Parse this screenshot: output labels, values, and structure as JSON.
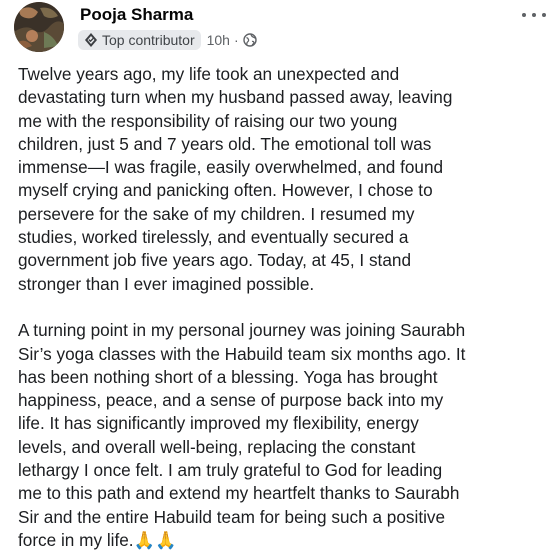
{
  "post": {
    "author_name": "Pooja Sharma",
    "badge_label": "Top contributor",
    "timestamp": "10h",
    "separator": "·",
    "audience_icon": "globe-icon",
    "badge_icon": "top-contributor-icon",
    "more_icon": "more-options-icon",
    "paragraphs": [
      "Twelve years ago, my life took an unexpected and\ndevastating turn when my husband passed away, leaving\nme with the responsibility of raising our two young\nchildren, just 5 and 7 years old. The emotional toll was\nimmense—I was fragile, easily overwhelmed, and found\nmyself crying and panicking often. However, I chose to\npersevere for the sake of my children. I resumed my\nstudies, worked tirelessly, and eventually secured a\ngovernment job five years ago. Today, at 45, I stand\nstronger than I ever imagined possible.",
      "A turning point in my personal journey was joining Saurabh\nSir’s yoga classes with the Habuild team six months ago. It\nhas been nothing short of a blessing. Yoga has brought\nhappiness, peace, and a sense of purpose back into my\nlife. It has significantly improved my flexibility, energy\nlevels, and overall well-being, replacing the constant\nlethargy I once felt. I am truly grateful to God for leading\nme to this path and extend my heartfelt thanks to Saurabh\nSir and the entire Habuild team for being such a positive\nforce in my life.🙏🙏"
    ]
  },
  "colors": {
    "text_primary": "#050505",
    "text_secondary": "#5f6266",
    "badge_bg": "#e7e9ec"
  }
}
